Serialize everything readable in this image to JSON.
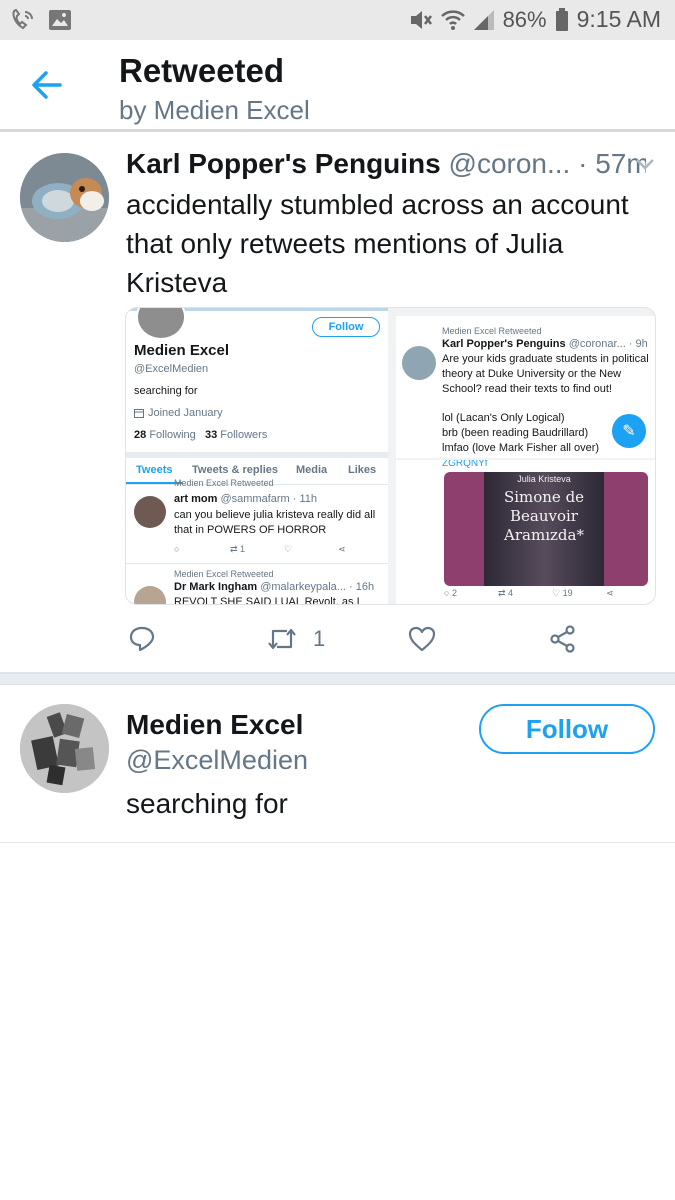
{
  "status_bar": {
    "battery": "86%",
    "time": "9:15 AM"
  },
  "header": {
    "title": "Retweeted",
    "subtitle": "by Medien Excel"
  },
  "tweet": {
    "name": "Karl Popper's Penguins",
    "handle": "@coron...",
    "time": "· 57m",
    "text": "accidentally stumbled across an account that only retweets mentions of Julia Kristeva",
    "retweet_count": "1",
    "media": {
      "left_profile": {
        "follow": "Follow",
        "name": "Medien Excel",
        "handle": "@ExcelMedien",
        "bio": "searching for",
        "joined": "Joined January",
        "following_count": "28",
        "following_label": "Following",
        "followers_count": "33",
        "followers_label": "Followers",
        "tabs": [
          "Tweets",
          "Tweets & replies",
          "Media",
          "Likes"
        ],
        "rt1_label": "Medien Excel Retweeted",
        "rt1_name": "art mom",
        "rt1_handle": "@sammafarm · 11h",
        "rt1_text": "can you believe julia kristeva really did all that in POWERS OF HORROR",
        "rt1_retweets": "1",
        "rt2_label": "Medien Excel Retweeted",
        "rt2_name": "Dr Mark Ingham",
        "rt2_handle": "@malarkeypala... · 16h",
        "rt2_text": "REVOLT SHE SAID I UAL Revolt, as I"
      },
      "right_tweet": {
        "rt_label": "Medien Excel Retweeted",
        "name": "Karl Popper's Penguins",
        "handle": "@coronar... · 9h",
        "text": "Are your kids graduate students in political theory at Duke University or the New School? read their texts to find out!",
        "line1": "lol (Lacan's Only Logical)",
        "line2": "brb (been reading Baudrillard)",
        "line3": "lmfao (love Mark Fisher all over)",
        "code": "ZGRQNYf",
        "book_author": "Julia Kristeva",
        "book_title": "Simone de Beauvoir Aramızda*",
        "replies": "2",
        "retweets": "4",
        "likes": "19"
      }
    }
  },
  "user_card": {
    "name": "Medien Excel",
    "handle": "@ExcelMedien",
    "bio": "searching for",
    "follow_label": "Follow"
  },
  "colors": {
    "accent": "#1da1f2",
    "muted": "#657786",
    "text": "#14171a",
    "book_bg": "#8e3f6e"
  }
}
